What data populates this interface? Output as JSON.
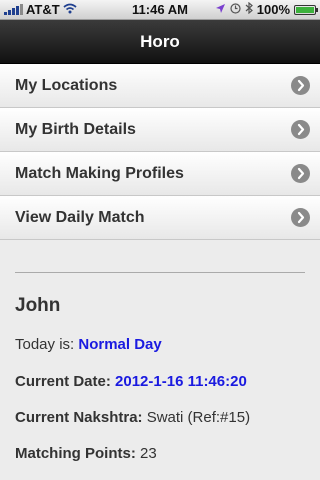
{
  "status_bar": {
    "carrier": "AT&T",
    "time": "11:46 AM",
    "battery": "100%",
    "battery_level": 1.0,
    "icons": [
      "signal-icon",
      "wifi-icon",
      "location-icon",
      "clock-icon",
      "bluetooth-icon",
      "battery-icon"
    ]
  },
  "nav": {
    "title": "Horo"
  },
  "menu": {
    "items": [
      {
        "label": "My Locations"
      },
      {
        "label": "My Birth Details"
      },
      {
        "label": "Match Making Profiles"
      },
      {
        "label": "View Daily Match"
      }
    ]
  },
  "details": {
    "name": "John",
    "today_label": "Today is:",
    "today_value": "Normal Day",
    "date_label": "Current Date:",
    "date_value": "2012-1-16 11:46:20",
    "nakshatra_label": "Current Nakshtra:",
    "nakshatra_value": "Swati (Ref:#15)",
    "points_label": "Matching Points:",
    "points_value": "23"
  },
  "colors": {
    "nav_bg": "#1c1c1c",
    "accent_blue": "#1a1ae0",
    "battery_green": "#3cb13c"
  }
}
